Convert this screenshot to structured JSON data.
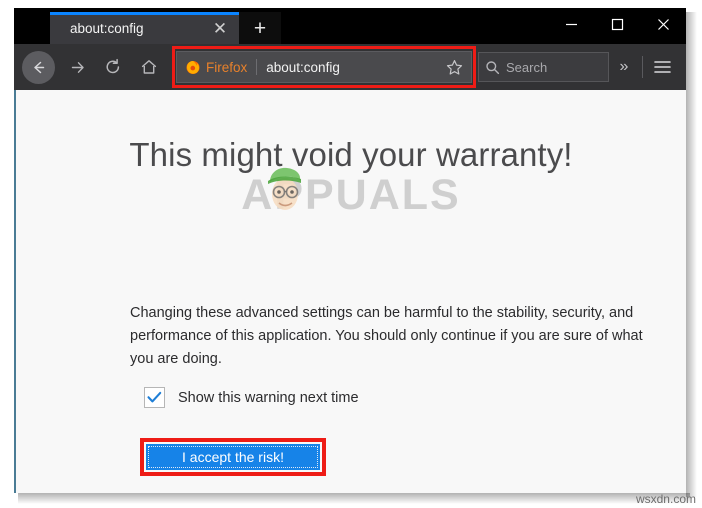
{
  "window": {
    "controls": {
      "minimize": "minimize-icon",
      "maximize": "maximize-icon",
      "close": "close-icon"
    }
  },
  "tabs": [
    {
      "title": "about:config",
      "active": true,
      "close_label": "✕"
    }
  ],
  "new_tab_label": "+",
  "toolbar": {
    "back_icon": "back-arrow-icon",
    "forward_icon": "forward-arrow-icon",
    "reload_icon": "reload-icon",
    "home_icon": "home-icon",
    "brand_label": "Firefox",
    "url_value": "about:config",
    "bookmark_icon": "star-icon",
    "overflow_label": "»",
    "menu_icon": "hamburger-menu-icon"
  },
  "search": {
    "placeholder": "Search",
    "icon": "search-icon"
  },
  "page": {
    "title": "This might void your warranty!",
    "body": "Changing these advanced settings can be harmful to the stability, security, and performance of this application. You should only continue if you are sure of what you are doing.",
    "checkbox_label": "Show this warning next time",
    "checkbox_checked": true,
    "accept_button": "I accept the risk!",
    "watermark": "APPUALS"
  },
  "site_watermark": "wsxdn.com",
  "colors": {
    "highlight_red": "#ee1c16",
    "accent_blue": "#1683e8",
    "tab_indicator": "#0a84ff",
    "brand_orange": "#e8812b",
    "content_bg": "#f8f8f8",
    "chrome_dark": "#323234"
  }
}
